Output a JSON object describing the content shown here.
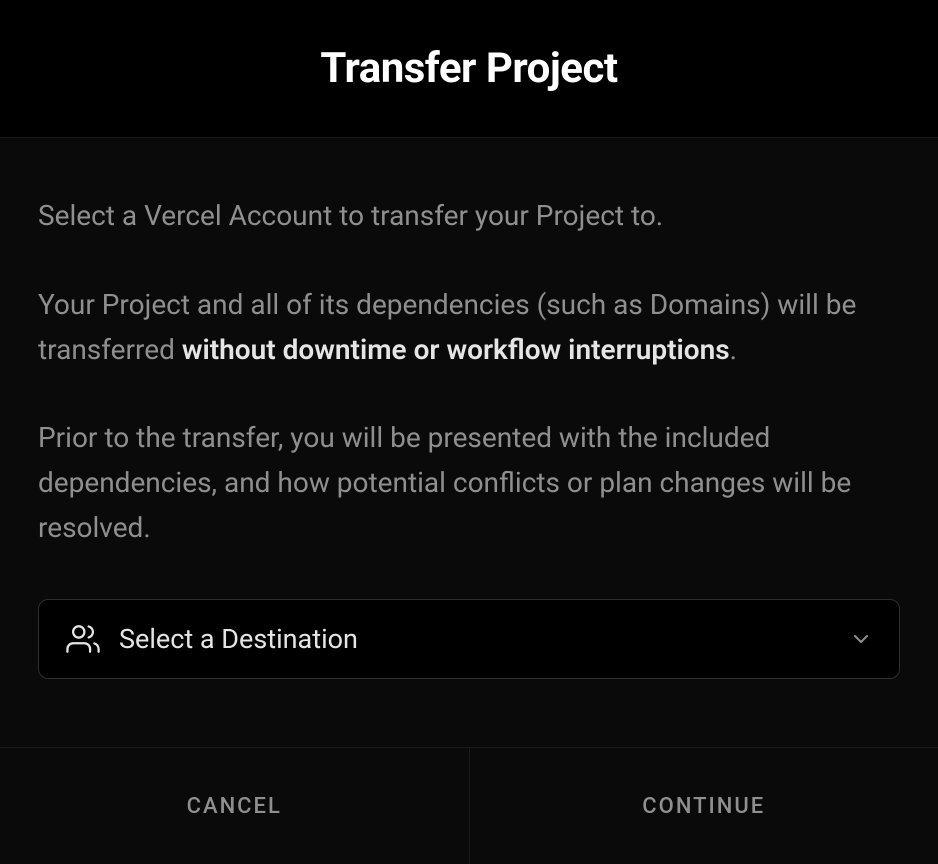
{
  "header": {
    "title": "Transfer Project"
  },
  "body": {
    "p1": "Select a Vercel Account to transfer your Project to.",
    "p2_a": "Your Project and all of its dependencies (such as Domains) will be transferred ",
    "p2_b_strong": "without downtime or workflow interruptions",
    "p2_c": ".",
    "p3": "Prior to the transfer, you will be presented with the included dependencies, and how potential conflicts or plan changes will be resolved."
  },
  "select": {
    "placeholder": "Select a Destination"
  },
  "footer": {
    "cancel": "CANCEL",
    "continue": "CONTINUE"
  }
}
